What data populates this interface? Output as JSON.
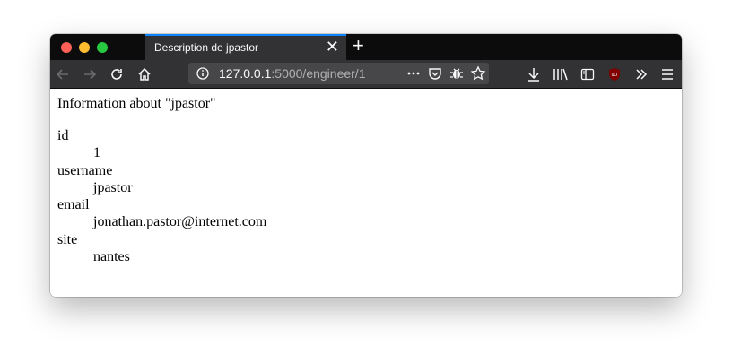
{
  "browser": {
    "tab_title": "Description de jpastor",
    "url_host": "127.0.0.1",
    "url_rest": ":5000/engineer/1"
  },
  "page": {
    "heading": "Information about \"jpastor\"",
    "fields": [
      {
        "label": "id",
        "value": "1"
      },
      {
        "label": "username",
        "value": "jpastor"
      },
      {
        "label": "email",
        "value": "jonathan.pastor@internet.com"
      },
      {
        "label": "site",
        "value": "nantes"
      }
    ]
  },
  "icons": [
    "back-arrow-icon",
    "forward-arrow-icon",
    "reload-icon",
    "home-icon",
    "info-icon",
    "more-actions-icon",
    "pocket-icon",
    "bug-icon",
    "bookmark-star-icon",
    "download-icon",
    "library-icon",
    "sidebar-icon",
    "ublock-icon",
    "overflow-chevron-icon",
    "menu-hamburger-icon"
  ]
}
